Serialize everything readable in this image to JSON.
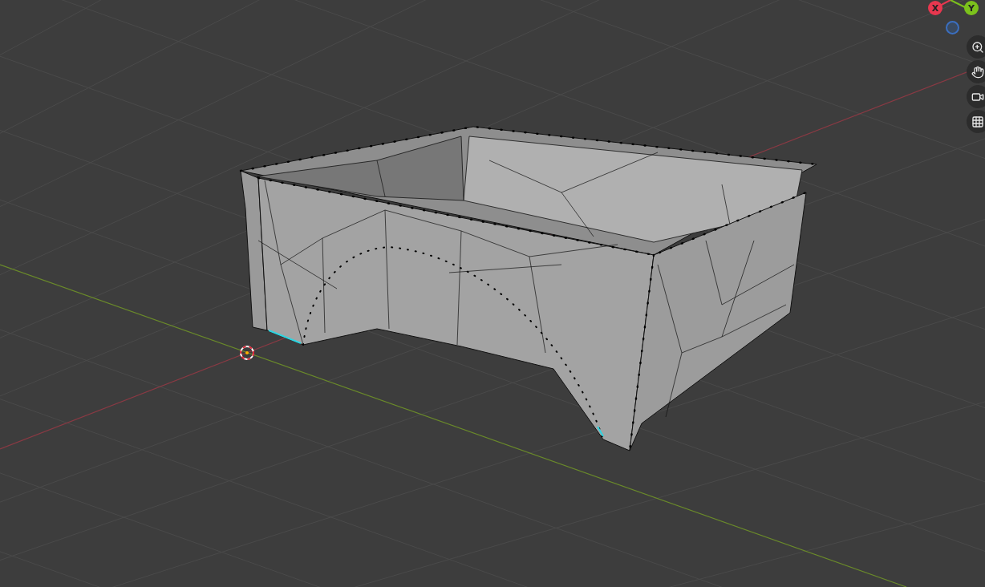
{
  "gizmo": {
    "axes": [
      {
        "label": "X",
        "color": "#e8374f"
      },
      {
        "label": "Y",
        "color": "#7cc21c"
      }
    ]
  },
  "nav_buttons": [
    {
      "kind": "zoom"
    },
    {
      "kind": "pan"
    },
    {
      "kind": "camera"
    },
    {
      "kind": "grid"
    }
  ]
}
